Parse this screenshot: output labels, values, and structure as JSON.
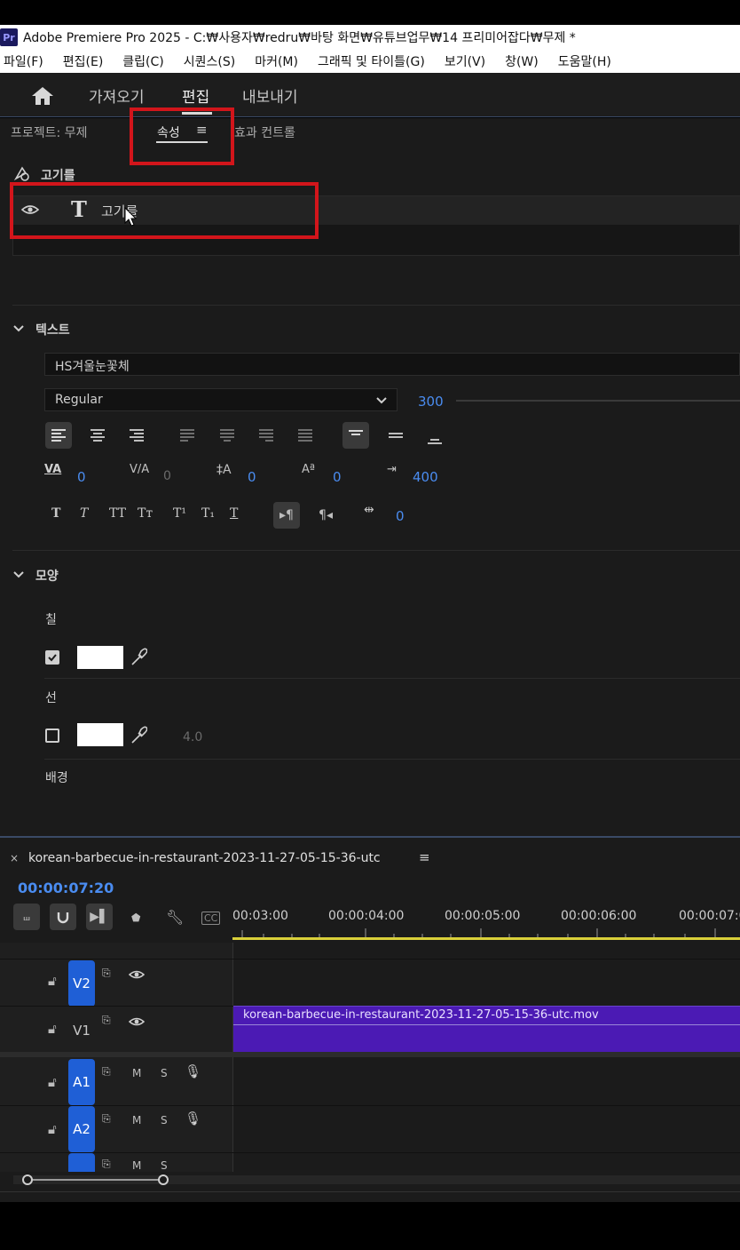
{
  "window": {
    "title": "Adobe Premiere Pro 2025 - C:₩사용자₩redru₩바탕 화면₩유튜브업무₩14 프리미어잡다₩무제 *",
    "logo": "Pr"
  },
  "menu": [
    "파일(F)",
    "편집(E)",
    "클립(C)",
    "시퀀스(S)",
    "마커(M)",
    "그래픽 및 타이틀(G)",
    "보기(V)",
    "창(W)",
    "도움말(H)"
  ],
  "workspace": {
    "tabs": [
      "가져오기",
      "편집",
      "내보내기"
    ],
    "active": "편집"
  },
  "panel": {
    "project_tab": "프로젝트: 무제",
    "properties_tab": "속성",
    "effect_controls_tab": "효과 컨트롤",
    "clip_name": "고기를",
    "layer_name": "고기를"
  },
  "text_section": {
    "title": "텍스트",
    "font_family": "HS겨울눈꽃체",
    "font_style": "Regular",
    "font_size": "300",
    "kerning": "0",
    "tracking": "0",
    "leading": "0",
    "baseline": "0",
    "tab_width": "400",
    "tsume": "0"
  },
  "appearance_section": {
    "title": "모양",
    "fill_label": "칠",
    "fill_color": "#ffffff",
    "fill_checked": true,
    "stroke_label": "선",
    "stroke_color": "#ffffff",
    "stroke_checked": false,
    "stroke_width": "4.0",
    "background_label": "배경"
  },
  "timeline": {
    "sequence_name": "korean-barbecue-in-restaurant-2023-11-27-05-15-36-utc",
    "timecode": "00:00:07:20",
    "ruler": [
      "00:03:00",
      "00:00:04:00",
      "00:00:05:00",
      "00:00:06:00",
      "00:00:07:0"
    ],
    "clip_name": "korean-barbecue-in-restaurant-2023-11-27-05-15-36-utc.mov",
    "tracks": {
      "v2": "V2",
      "v1": "V1",
      "a1": "A1",
      "a2": "A2",
      "m": "M",
      "s": "S"
    }
  },
  "colors": {
    "accent_blue": "#4a8cf0",
    "highlight_red": "#d2151b",
    "clip_purple": "#4b1ab4",
    "track_blue": "#1f5fd6"
  }
}
